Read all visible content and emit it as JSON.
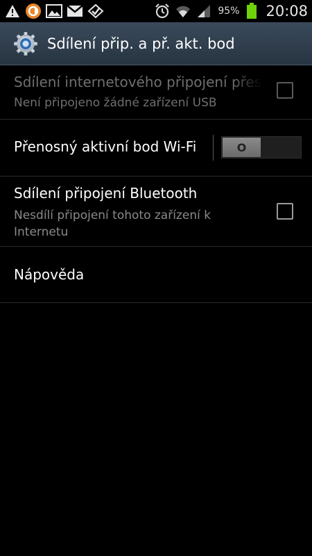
{
  "status_bar": {
    "left_icons": [
      "warning-icon",
      "app-icon",
      "image-icon",
      "gmail-icon",
      "check-icon"
    ],
    "right_icons": [
      "alarm-icon",
      "wifi-icon",
      "signal-icon",
      "battery-icon"
    ],
    "battery_percent": "95%",
    "time": "20:08"
  },
  "title_bar": {
    "title": "Sdílení přip. a př. akt. bod",
    "icon": "settings-gear-icon"
  },
  "items": {
    "usb": {
      "title": "Sdílení internetového připojení přes USB",
      "subtitle": "Není připojeno žádné zařízení USB",
      "enabled": false
    },
    "hotspot": {
      "title": "Přenosný aktivní bod Wi-Fi",
      "toggle_label": "O"
    },
    "bluetooth": {
      "title": "Sdílení připojení Bluetooth",
      "subtitle": "Nesdílí připojení tohoto zařízení k Internetu"
    },
    "help": {
      "title": "Nápověda"
    }
  },
  "colors": {
    "background": "#000000",
    "title_bar": "#2f3c4a",
    "battery": "#6fd20a",
    "disabled_text": "#6f6f6f",
    "subtitle_text": "#8a8a8a"
  }
}
